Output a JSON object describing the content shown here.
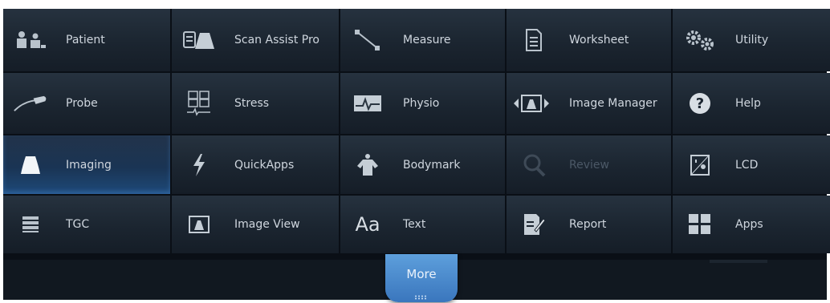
{
  "tiles": [
    {
      "label": "Patient",
      "icon": "patient-icon"
    },
    {
      "label": "Scan Assist Pro",
      "icon": "scan-assist-icon"
    },
    {
      "label": "Measure",
      "icon": "measure-icon"
    },
    {
      "label": "Worksheet",
      "icon": "worksheet-icon"
    },
    {
      "label": "Utility",
      "icon": "gears-icon"
    },
    {
      "label": "Probe",
      "icon": "probe-icon"
    },
    {
      "label": "Stress",
      "icon": "stress-icon"
    },
    {
      "label": "Physio",
      "icon": "physio-icon"
    },
    {
      "label": "Image Manager",
      "icon": "image-manager-icon"
    },
    {
      "label": "Help",
      "icon": "help-icon"
    },
    {
      "label": "Imaging",
      "icon": "imaging-icon",
      "state": "active"
    },
    {
      "label": "QuickApps",
      "icon": "lightning-icon"
    },
    {
      "label": "Bodymark",
      "icon": "bodymark-icon"
    },
    {
      "label": "Review",
      "icon": "review-icon",
      "state": "disabled"
    },
    {
      "label": "LCD",
      "icon": "lcd-icon"
    },
    {
      "label": "TGC",
      "icon": "tgc-icon"
    },
    {
      "label": "Image View",
      "icon": "image-view-icon"
    },
    {
      "label": "Text",
      "icon": "text-icon",
      "icon_text": "Aa"
    },
    {
      "label": "Report",
      "icon": "report-icon"
    },
    {
      "label": "Apps",
      "icon": "apps-icon"
    }
  ],
  "more_button": {
    "label": "More"
  },
  "colors": {
    "active_tile": "#1e4a79",
    "accent": "#4b8fd3",
    "text": "#cfd6de",
    "disabled_text": "#4b5866"
  }
}
